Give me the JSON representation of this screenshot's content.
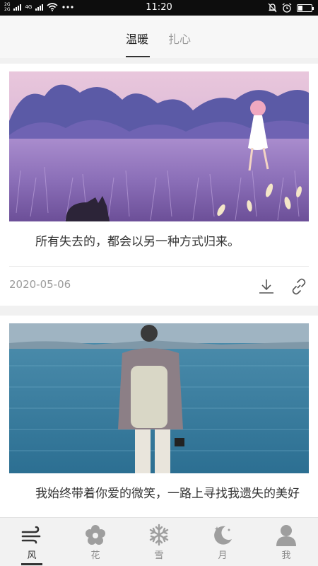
{
  "status_bar": {
    "sim1": "2G",
    "sim2": "2G",
    "network": "4G",
    "time": "11:20",
    "battery_level": 0.35,
    "icons": [
      "signal-icon",
      "wifi-icon",
      "more-dots-icon",
      "alarm-off-icon",
      "alarm-clock-icon",
      "battery-icon"
    ]
  },
  "top_tabs": [
    {
      "label": "温暖",
      "active": true
    },
    {
      "label": "扎心",
      "active": false
    }
  ],
  "feed": [
    {
      "image": "illustration of a girl in a white dress walking through a purple field, a black cat in the foreground",
      "text": "所有失去的，都会以另一种方式归来。",
      "date": "2020-05-06",
      "actions": [
        "download-icon",
        "link-icon"
      ]
    },
    {
      "image": "photo of a man with a backpack and camera looking out over a blue sea",
      "text": "我始终带着你爱的微笑，一路上寻找我遗失的美好"
    }
  ],
  "bottom_nav": [
    {
      "label": "风",
      "icon": "wind-icon",
      "active": true
    },
    {
      "label": "花",
      "icon": "flower-icon",
      "active": false
    },
    {
      "label": "雪",
      "icon": "snowflake-icon",
      "active": false
    },
    {
      "label": "月",
      "icon": "moon-icon",
      "active": false
    },
    {
      "label": "我",
      "icon": "user-icon",
      "active": false
    }
  ],
  "colors": {
    "active_text": "#333333",
    "inactive_text": "#9a9a9a",
    "icon_gray": "#9e9e9e"
  }
}
